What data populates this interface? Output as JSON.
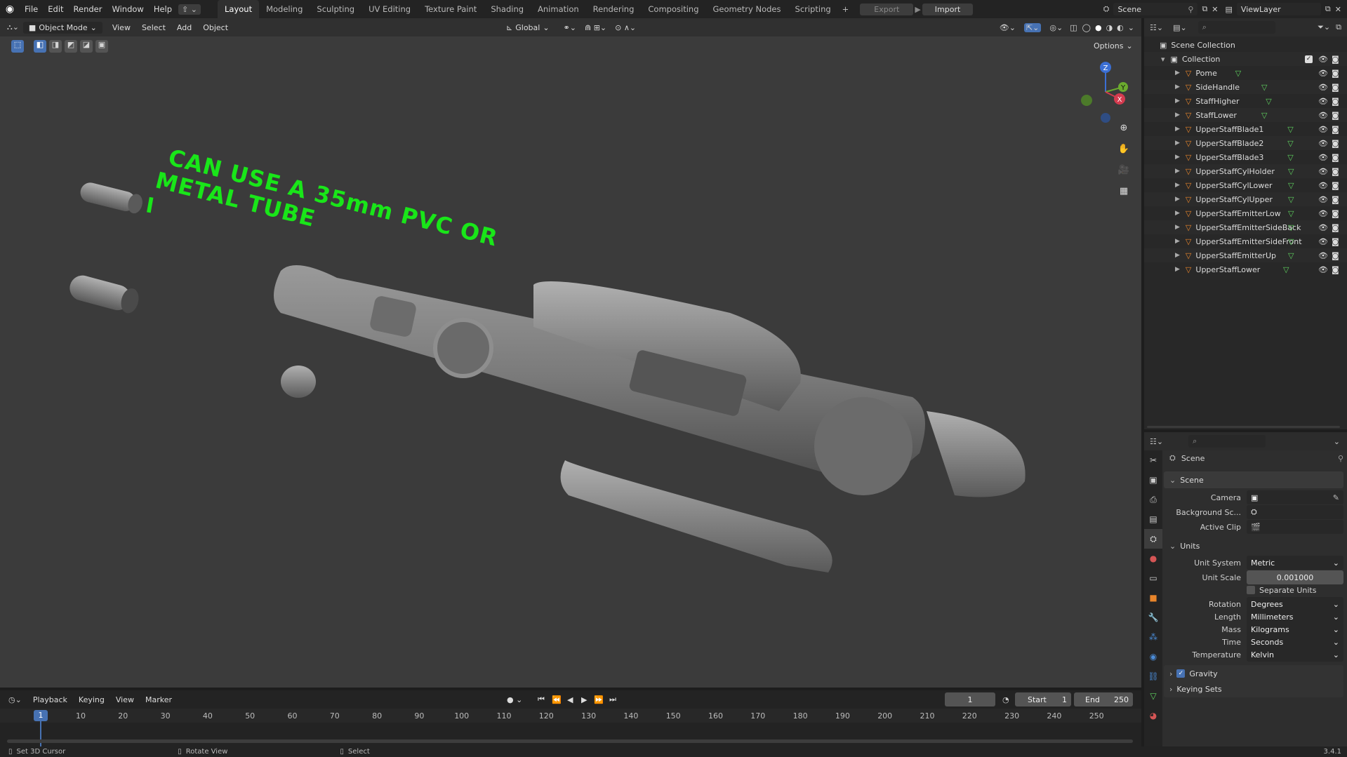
{
  "topbar": {
    "menus": [
      "File",
      "Edit",
      "Render",
      "Window",
      "Help"
    ],
    "workspaces": [
      "Layout",
      "Modeling",
      "Sculpting",
      "UV Editing",
      "Texture Paint",
      "Shading",
      "Animation",
      "Rendering",
      "Compositing",
      "Geometry Nodes",
      "Scripting"
    ],
    "active_workspace": "Layout",
    "add_tab": "+",
    "export_label": "Export",
    "import_label": "Import",
    "scene_name": "Scene",
    "view_layer": "ViewLayer"
  },
  "viewport_header": {
    "mode": "Object Mode",
    "menus": [
      "View",
      "Select",
      "Add",
      "Object"
    ],
    "orientation": "Global",
    "options_label": "Options"
  },
  "viewport": {
    "annotation_line1": "CAN USE A 35mm PVC OR",
    "annotation_line2": "METAL TUBE",
    "annotation_color": "#19e619",
    "gizmo": {
      "z": "Z",
      "y": "Y",
      "x": "X"
    }
  },
  "outliner": {
    "scene_collection": "Scene Collection",
    "collection": "Collection",
    "items": [
      "Pome",
      "SideHandle",
      "StaffHigher",
      "StaffLower",
      "UpperStaffBlade1",
      "UpperStaffBlade2",
      "UpperStaffBlade3",
      "UpperStaffCylHolder",
      "UpperStaffCylLower",
      "UpperStaffCylUpper",
      "UpperStaffEmitterLow",
      "UpperStaffEmitterSideBack",
      "UpperStaffEmitterSideFront",
      "UpperStaffEmitterUp",
      "UpperStaffLower"
    ]
  },
  "properties": {
    "context": "Scene",
    "scene_section": "Scene",
    "camera_label": "Camera",
    "background_label": "Background Sc...",
    "active_clip_label": "Active Clip",
    "units_section": "Units",
    "unit_system_label": "Unit System",
    "unit_system": "Metric",
    "unit_scale_label": "Unit Scale",
    "unit_scale": "0.001000",
    "separate_units": "Separate Units",
    "rotation_label": "Rotation",
    "rotation": "Degrees",
    "length_label": "Length",
    "length": "Millimeters",
    "mass_label": "Mass",
    "mass": "Kilograms",
    "time_label": "Time",
    "time": "Seconds",
    "temperature_label": "Temperature",
    "temperature": "Kelvin",
    "gravity": "Gravity",
    "keying_sets": "Keying Sets"
  },
  "timeline": {
    "menus": [
      "Playback",
      "Keying",
      "View",
      "Marker"
    ],
    "current_frame": "1",
    "start_label": "Start",
    "start": "1",
    "end_label": "End",
    "end": "250",
    "ticks": [
      "10",
      "20",
      "30",
      "40",
      "50",
      "60",
      "70",
      "80",
      "90",
      "100",
      "110",
      "120",
      "130",
      "140",
      "150",
      "160",
      "170",
      "180",
      "190",
      "200",
      "210",
      "220",
      "230",
      "240",
      "250"
    ],
    "frame_marker": "1"
  },
  "statusbar": {
    "hint1": "Set 3D Cursor",
    "hint2": "Rotate View",
    "hint3": "Select",
    "version": "3.4.1"
  }
}
